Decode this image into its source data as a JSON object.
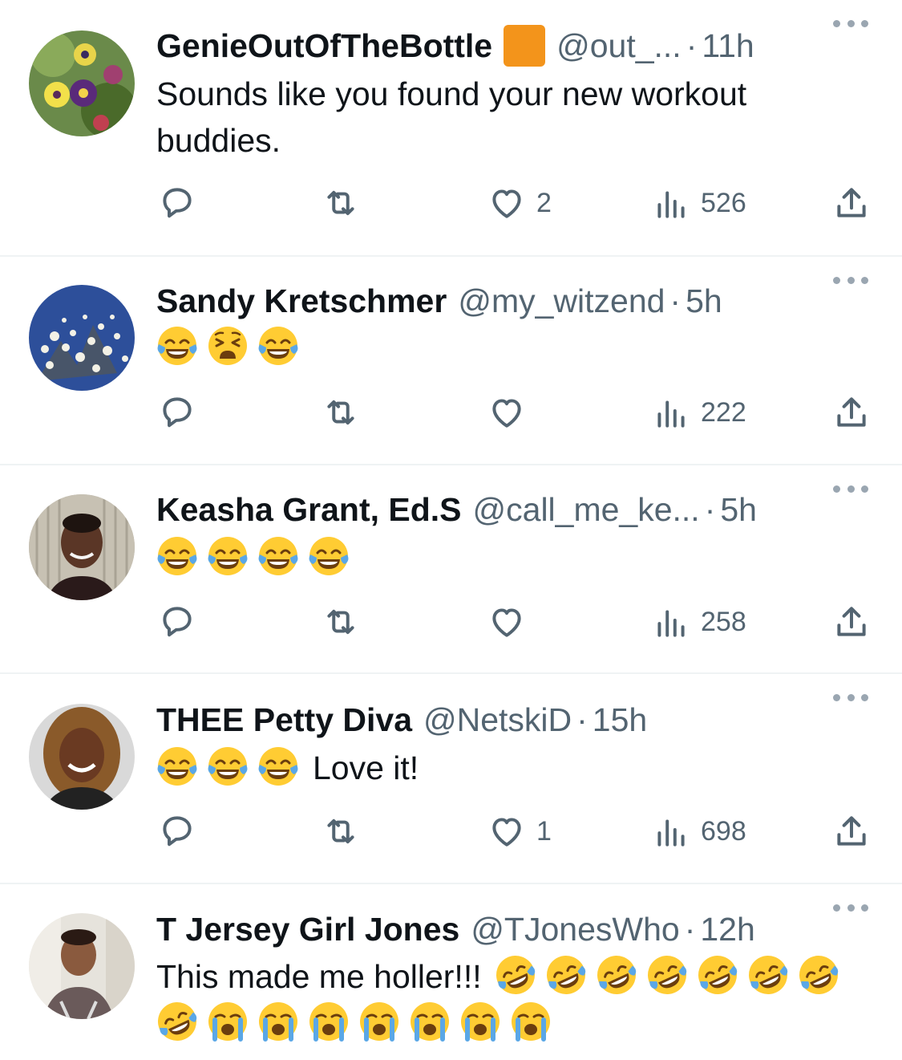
{
  "colors": {
    "text": "#0f1419",
    "secondary": "#536471",
    "divider": "#eff3f4",
    "badge": "#f3941b",
    "icon": "#536471"
  },
  "tweets": [
    {
      "name": "GenieOutOfTheBottle",
      "has_badge": true,
      "handle": "@out_...",
      "separator": "·",
      "time": "11h",
      "text": "Sounds like you found your new workout buddies.",
      "emojis": [],
      "likes": "2",
      "views": "526",
      "avatar": "flowers-avatar"
    },
    {
      "name": "Sandy Kretschmer",
      "has_badge": false,
      "handle": "@my_witzend",
      "separator": "·",
      "time": "5h",
      "text": "",
      "emojis": [
        "face-with-tears-of-joy",
        "weary-face",
        "face-with-tears-of-joy"
      ],
      "likes": "",
      "views": "222",
      "avatar": "blossom-tree-avatar"
    },
    {
      "name": "Keasha Grant, Ed.S",
      "has_badge": false,
      "handle": "@call_me_ke...",
      "separator": "·",
      "time": "5h",
      "text": "",
      "emojis": [
        "face-with-tears-of-joy",
        "face-with-tears-of-joy",
        "face-with-tears-of-joy",
        "face-with-tears-of-joy"
      ],
      "likes": "",
      "views": "258",
      "avatar": "woman-portrait-avatar"
    },
    {
      "name": "THEE Petty Diva",
      "has_badge": false,
      "handle": "@NetskiD",
      "separator": "·",
      "time": "15h",
      "text": "Love it!",
      "emojis": [
        "face-with-tears-of-joy",
        "face-with-tears-of-joy",
        "face-with-tears-of-joy"
      ],
      "likes": "1",
      "views": "698",
      "avatar": "woman-portrait-avatar"
    },
    {
      "name": "T Jersey Girl Jones",
      "has_badge": false,
      "handle": "@TJonesWho",
      "separator": "·",
      "time": "12h",
      "text": "This made me holler!!!",
      "emojis": [
        "rolling-on-floor-laughing",
        "rolling-on-floor-laughing",
        "rolling-on-floor-laughing",
        "rolling-on-floor-laughing",
        "rolling-on-floor-laughing",
        "rolling-on-floor-laughing",
        "rolling-on-floor-laughing",
        "rolling-on-floor-laughing",
        "loudly-crying-face",
        "loudly-crying-face",
        "loudly-crying-face",
        "loudly-crying-face",
        "loudly-crying-face",
        "loudly-crying-face",
        "loudly-crying-face"
      ],
      "likes": "",
      "views": "",
      "avatar": "selfie-avatar"
    }
  ]
}
